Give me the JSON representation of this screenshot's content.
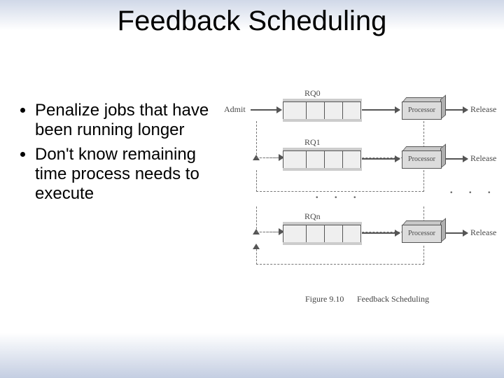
{
  "title": "Feedback Scheduling",
  "bullets": [
    "Penalize jobs that have been running longer",
    "Don't know remaining time process needs to execute"
  ],
  "diagram": {
    "admit_label": "Admit",
    "release_label": "Release",
    "processor_label": "Processor",
    "queues": [
      "RQ0",
      "RQ1",
      "RQn"
    ],
    "ellipsis_mid": ". . .",
    "ellipsis_right": ". . .",
    "caption_fig": "Figure 9.10",
    "caption_title": "Feedback Scheduling"
  }
}
